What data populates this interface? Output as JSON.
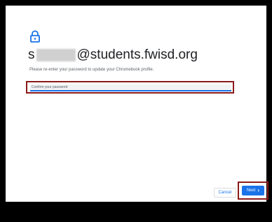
{
  "header": {
    "lock_icon": "lock-icon",
    "email_initial": "s",
    "email_domain": "@students.fwisd.org",
    "subtitle": "Please re-enter your password to update your Chromebook profile."
  },
  "form": {
    "password_placeholder": "Confirm your password"
  },
  "actions": {
    "cancel_label": "Cancel",
    "next_label": "Next",
    "next_icon": "chevron-right-icon"
  },
  "colors": {
    "accent": "#1a73e8",
    "highlight_border": "#8b1a1a"
  }
}
